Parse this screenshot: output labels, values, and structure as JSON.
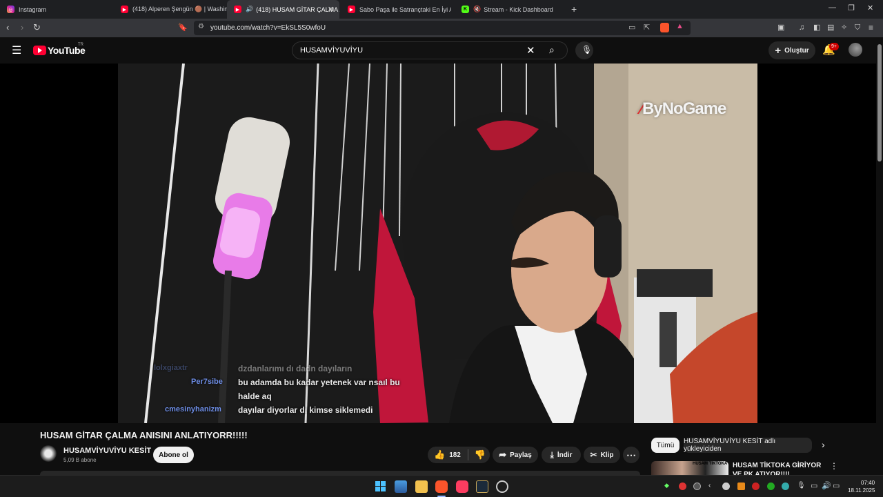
{
  "browser": {
    "tabs": [
      {
        "label": "Instagram"
      },
      {
        "label": "(418) Alperen Şengün 🟤 | Washingt"
      },
      {
        "label": "(418) HUSAM GİTAR ÇALMA A"
      },
      {
        "label": "Sabo Paşa ile Satrançtaki En İyi Açılış"
      },
      {
        "label": "Stream - Kick Dashboard"
      }
    ],
    "new_tab": "+",
    "url": "youtube.com/watch?v=EkSL5S0wfoU"
  },
  "youtube": {
    "logo": "YouTube",
    "region": "TR",
    "search_value": "HUSAMVİYUVİYU",
    "create_label": "Oluştur",
    "notif_count": "9+"
  },
  "video": {
    "watermark": "ByNoGame",
    "chat": [
      {
        "name": "lolxgiaxtr",
        "text": "dzdanlarımı dı dadn dayıların"
      },
      {
        "name": "Per7sibe",
        "text": "bu adamda bu kadar yetenek var nsaıl bu"
      },
      {
        "name": "",
        "text": "halde aq"
      },
      {
        "name": "cmesinyhanizm",
        "text": "dayılar diyorlar dı kimse siklemedi"
      }
    ],
    "title": "HUSAM GİTAR ÇALMA ANISINI ANLATIYORR!!!!!",
    "channel": "HUSAMVİYUVİYU KESİT",
    "subscribers": "5,09 B abone",
    "subscribe_label": "Abone ol",
    "likes": "182",
    "share_label": "Paylaş",
    "download_label": "İndir",
    "clip_label": "Klip"
  },
  "sidebar": {
    "chips": [
      "Tümü",
      "HUSAMVİYUVİYU KESİT adlı yükleyiciden"
    ],
    "rec_title": "HUSAM TİKTOKA GİRİYOR VE PK ATIYOR!!!!",
    "rec_thumb_text": "HUSAM TİKTOKA"
  },
  "taskbar": {
    "time": "07:40",
    "date": "18.11.2025"
  },
  "colors": {
    "youtube_red": "#ff0033",
    "chat_name": "#6f8fe8",
    "notif_badge": "#cc0000"
  }
}
